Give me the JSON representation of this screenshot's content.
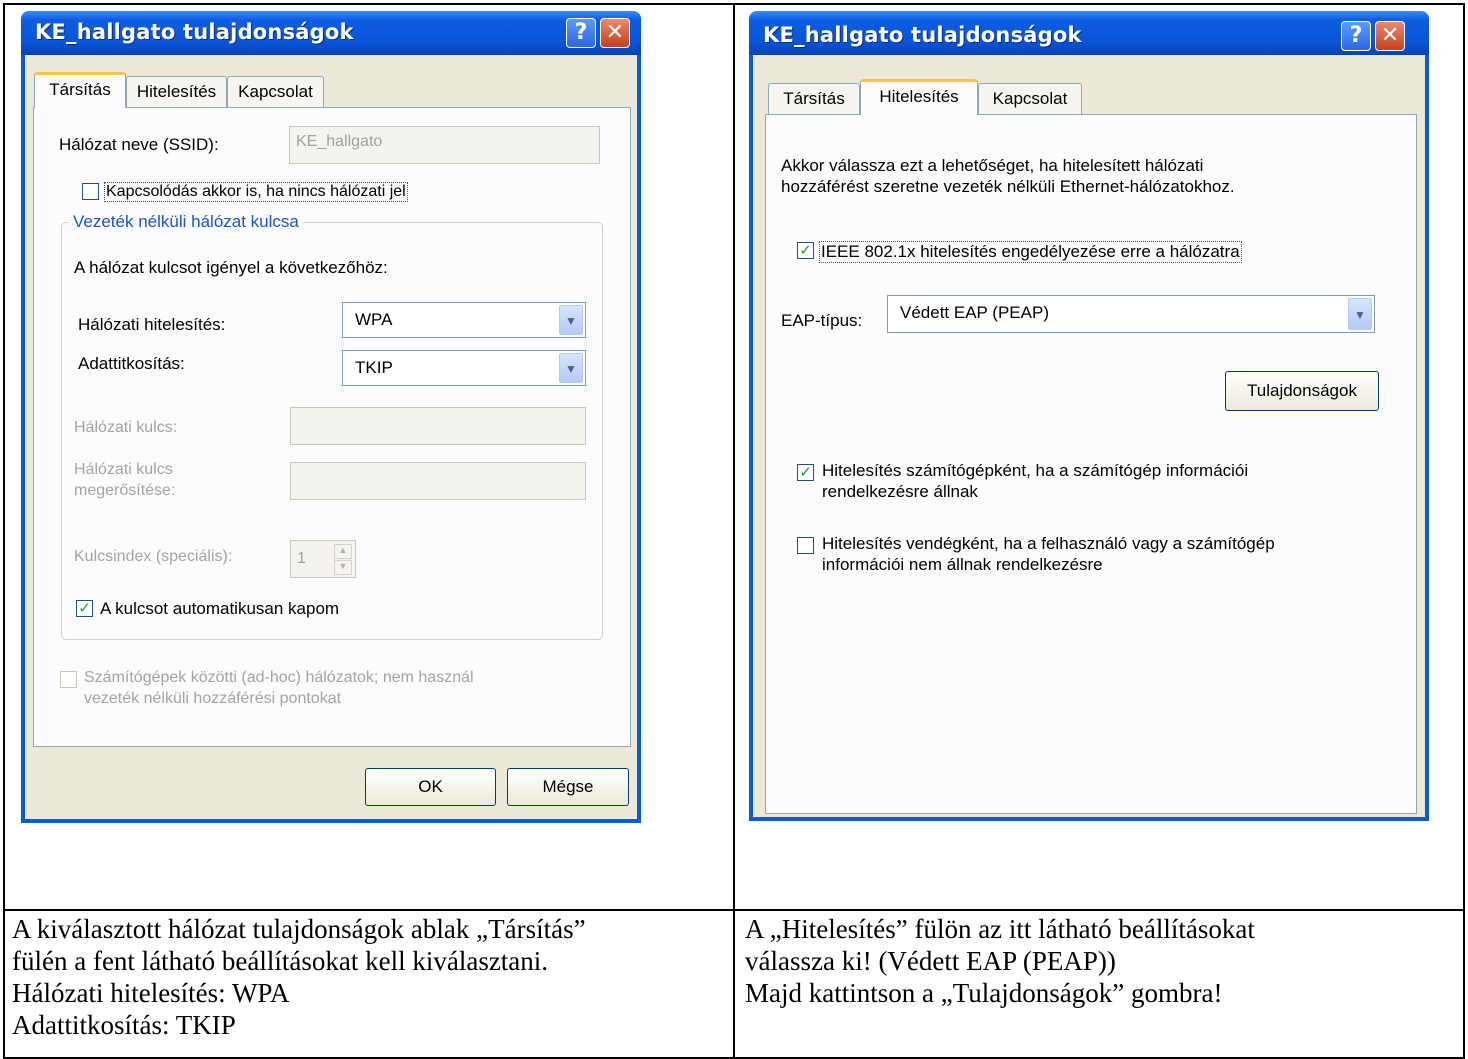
{
  "left_dialog": {
    "title": "KE_hallgato tulajdonságok",
    "help_button": "?",
    "close_button": "✕",
    "tabs": [
      "Társítás",
      "Hitelesítés",
      "Kapcsolat"
    ],
    "ssid_label": "Hálózat neve (SSID):",
    "ssid_value": "KE_hallgato",
    "connect_even_if_no_broadcast": "Kapcsolódás akkor is, ha nincs hálózati jel",
    "group_title": "Vezeték nélküli hálózat kulcsa",
    "key_required_text": "A hálózat kulcsot igényel a következőhöz:",
    "auth_label": "Hálózati hitelesítés:",
    "auth_value": "WPA",
    "encryption_label": "Adattitkosítás:",
    "encryption_value": "TKIP",
    "network_key_label": "Hálózati kulcs:",
    "confirm_key_label_1": "Hálózati kulcs",
    "confirm_key_label_2": "megerősítése:",
    "key_index_label": "Kulcsindex (speciális):",
    "key_index_value": "1",
    "auto_key_label": "A kulcsot automatikusan kapom",
    "adhoc_line_1": "Számítógépek közötti (ad-hoc) hálózatok; nem használ",
    "adhoc_line_2": "vezeték nélküli hozzáférési pontokat",
    "ok_button": "OK",
    "cancel_button": "Mégse"
  },
  "right_dialog": {
    "title": "KE_hallgato tulajdonságok",
    "help_button": "?",
    "close_button": "✕",
    "tabs": [
      "Társítás",
      "Hitelesítés",
      "Kapcsolat"
    ],
    "intro_line_1": "Akkor válassza ezt a lehetőséget, ha hitelesített hálózati",
    "intro_line_2": "hozzáférést szeretne vezeték nélküli Ethernet-hálózatokhoz.",
    "ieee_label": "IEEE 802.1x hitelesítés engedélyezése erre a hálózatra",
    "eap_label": "EAP-típus:",
    "eap_value": "Védett EAP (PEAP)",
    "properties_button": "Tulajdonságok",
    "computer_auth_line_1": "Hitelesítés számítógépként, ha a számítógép információi",
    "computer_auth_line_2": "rendelkezésre állnak",
    "guest_auth_line_1": "Hitelesítés vendégként, ha a felhasználó vagy a számítógép",
    "guest_auth_line_2": "információi nem állnak rendelkezésre"
  },
  "captions": {
    "left": [
      "A kiválasztott hálózat tulajdonságok ablak „Társítás”",
      "fülén a fent látható beállításokat kell kiválasztani.",
      "Hálózati hitelesítés: WPA",
      "Adattitkosítás: TKIP"
    ],
    "right": [
      "A „Hitelesítés” fülön az itt látható beállításokat",
      "válassza ki! (Védett EAP (PEAP))",
      "Majd kattintson a „Tulajdonságok” gombra!"
    ]
  }
}
